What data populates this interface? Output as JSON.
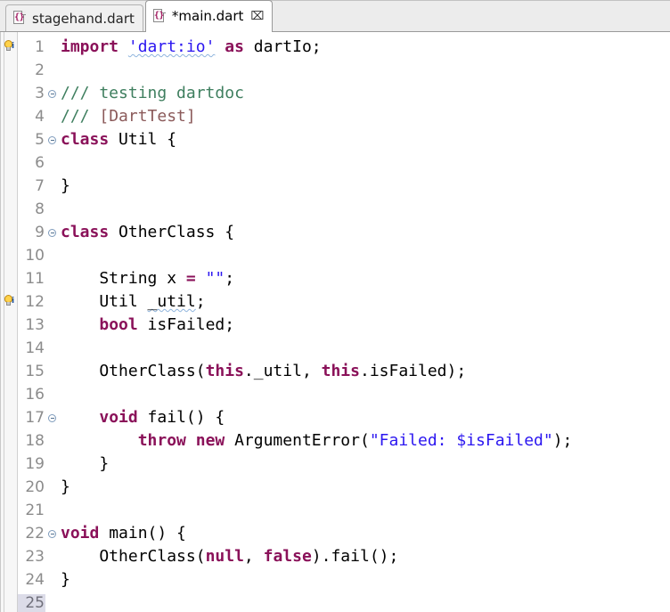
{
  "tabs": [
    {
      "label": "stagehand.dart",
      "active": false,
      "icon": "dart-file-icon",
      "closable": false
    },
    {
      "label": "*main.dart",
      "active": true,
      "icon": "dart-file-icon",
      "closable": true,
      "close_glyph": "⌧"
    }
  ],
  "colors": {
    "keyword": "#8a1159",
    "string": "#2b16f0",
    "comment": "#3f7f5f",
    "docref": "#8b5a5a",
    "plain": "#000000",
    "gutter_text": "#8c8c8c",
    "current_line_highlight": "#dcdce8",
    "tabbar_background": "#ececec",
    "editor_background": "#ffffff"
  },
  "editor": {
    "current_line": 25,
    "annotations": [
      {
        "line": 1,
        "type": "info-bulb-icon"
      },
      {
        "line": 12,
        "type": "info-bulb-icon"
      }
    ],
    "fold_lines": [
      3,
      5,
      9,
      17,
      22
    ],
    "lines": [
      {
        "n": 1,
        "tokens": [
          {
            "t": "import",
            "c": "kw"
          },
          {
            "t": " ",
            "c": "plain"
          },
          {
            "t": "'dart:io'",
            "c": "str squiggle"
          },
          {
            "t": " ",
            "c": "plain"
          },
          {
            "t": "as",
            "c": "kw"
          },
          {
            "t": " dartIo;",
            "c": "plain"
          }
        ]
      },
      {
        "n": 2,
        "tokens": []
      },
      {
        "n": 3,
        "tokens": [
          {
            "t": "/// testing dartdoc",
            "c": "cmt"
          }
        ]
      },
      {
        "n": 4,
        "tokens": [
          {
            "t": "/// ",
            "c": "cmt"
          },
          {
            "t": "[DartTest]",
            "c": "docref"
          }
        ]
      },
      {
        "n": 5,
        "tokens": [
          {
            "t": "class",
            "c": "kw"
          },
          {
            "t": " Util {",
            "c": "plain"
          }
        ]
      },
      {
        "n": 6,
        "tokens": []
      },
      {
        "n": 7,
        "tokens": [
          {
            "t": "}",
            "c": "plain"
          }
        ]
      },
      {
        "n": 8,
        "tokens": []
      },
      {
        "n": 9,
        "tokens": [
          {
            "t": "class",
            "c": "kw"
          },
          {
            "t": " OtherClass {",
            "c": "plain"
          }
        ]
      },
      {
        "n": 10,
        "tokens": []
      },
      {
        "n": 11,
        "tokens": [
          {
            "t": "    String x ",
            "c": "plain"
          },
          {
            "t": "=",
            "c": "kw"
          },
          {
            "t": " ",
            "c": "plain"
          },
          {
            "t": "\"\"",
            "c": "str"
          },
          {
            "t": ";",
            "c": "plain"
          }
        ]
      },
      {
        "n": 12,
        "tokens": [
          {
            "t": "    Util ",
            "c": "plain"
          },
          {
            "t": "_util",
            "c": "plain squiggle"
          },
          {
            "t": ";",
            "c": "plain"
          }
        ]
      },
      {
        "n": 13,
        "tokens": [
          {
            "t": "    ",
            "c": "plain"
          },
          {
            "t": "bool",
            "c": "kw"
          },
          {
            "t": " isFailed;",
            "c": "plain"
          }
        ]
      },
      {
        "n": 14,
        "tokens": []
      },
      {
        "n": 15,
        "tokens": [
          {
            "t": "    OtherClass(",
            "c": "plain"
          },
          {
            "t": "this",
            "c": "kw"
          },
          {
            "t": "._util, ",
            "c": "plain"
          },
          {
            "t": "this",
            "c": "kw"
          },
          {
            "t": ".isFailed);",
            "c": "plain"
          }
        ]
      },
      {
        "n": 16,
        "tokens": []
      },
      {
        "n": 17,
        "tokens": [
          {
            "t": "    ",
            "c": "plain"
          },
          {
            "t": "void",
            "c": "kw"
          },
          {
            "t": " fail() {",
            "c": "plain"
          }
        ]
      },
      {
        "n": 18,
        "tokens": [
          {
            "t": "        ",
            "c": "plain"
          },
          {
            "t": "throw",
            "c": "kw"
          },
          {
            "t": " ",
            "c": "plain"
          },
          {
            "t": "new",
            "c": "kw"
          },
          {
            "t": " ArgumentError(",
            "c": "plain"
          },
          {
            "t": "\"Failed: $isFailed\"",
            "c": "str"
          },
          {
            "t": ");",
            "c": "plain"
          }
        ]
      },
      {
        "n": 19,
        "tokens": [
          {
            "t": "    }",
            "c": "plain"
          }
        ]
      },
      {
        "n": 20,
        "tokens": [
          {
            "t": "}",
            "c": "plain"
          }
        ]
      },
      {
        "n": 21,
        "tokens": []
      },
      {
        "n": 22,
        "tokens": [
          {
            "t": "void",
            "c": "kw"
          },
          {
            "t": " main() {",
            "c": "plain"
          }
        ]
      },
      {
        "n": 23,
        "tokens": [
          {
            "t": "    OtherClass(",
            "c": "plain"
          },
          {
            "t": "null",
            "c": "kw"
          },
          {
            "t": ", ",
            "c": "plain"
          },
          {
            "t": "false",
            "c": "kw"
          },
          {
            "t": ").fail();",
            "c": "plain"
          }
        ]
      },
      {
        "n": 24,
        "tokens": [
          {
            "t": "}",
            "c": "plain"
          }
        ]
      },
      {
        "n": 25,
        "tokens": []
      }
    ]
  }
}
